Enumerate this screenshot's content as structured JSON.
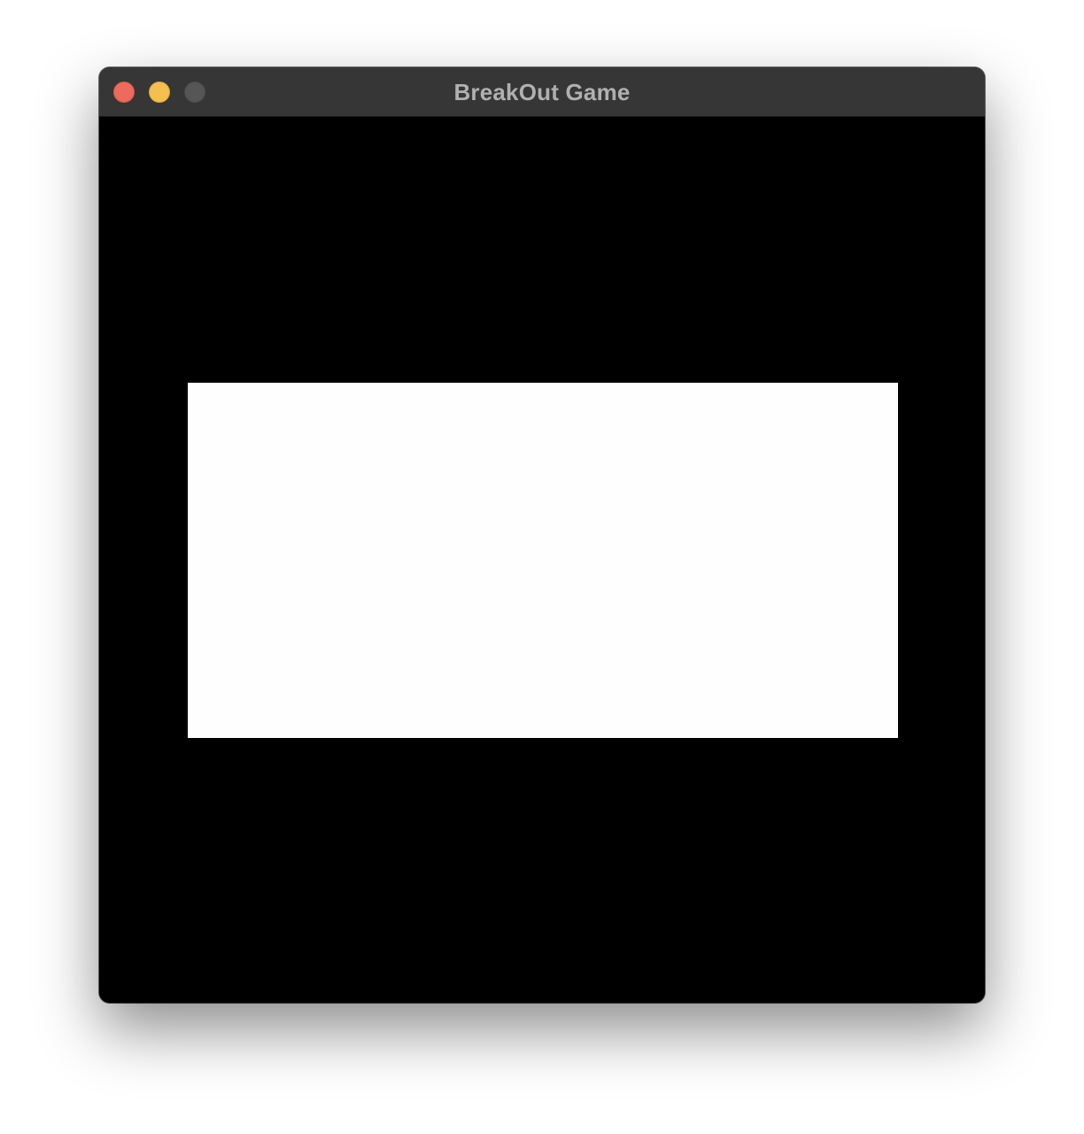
{
  "window": {
    "title": "BreakOut Game",
    "controls": {
      "close_color": "#ed6a5e",
      "minimize_color": "#f5bf4f",
      "zoom_color": "#555655"
    }
  },
  "game": {
    "background_color": "#000000",
    "panel_color": "#fefefe"
  }
}
